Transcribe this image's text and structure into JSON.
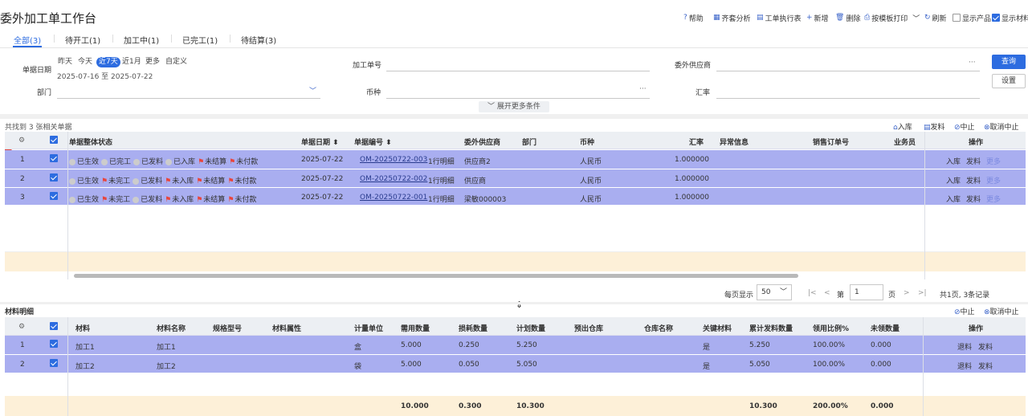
{
  "header": {
    "title": "委外加工单工作台",
    "toolbar": {
      "help": "帮助",
      "kit_analysis": "齐套分析",
      "exec_table": "工单执行表",
      "new": "新增",
      "delete": "删除",
      "print": "按模板打印",
      "refresh": "刷新",
      "show_product": "显示产品",
      "show_material": "显示材料"
    }
  },
  "tabs": [
    "全部(3)",
    "待开工(1)",
    "加工中(1)",
    "已完工(1)",
    "待结算(3)"
  ],
  "filters": {
    "date_label": "单据日期",
    "date_chips": [
      "昨天",
      "今天",
      "近7天",
      "近1月",
      "更多",
      "自定义"
    ],
    "date_range": "2025-07-16 至 2025-07-22",
    "order_no_label": "加工单号",
    "supplier_label": "委外供应商",
    "dept_label": "部门",
    "currency_label": "币种",
    "rate_label": "汇率",
    "ellipsis": "···",
    "search_btn": "查询",
    "settings_btn": "设置",
    "expand": "展开更多条件"
  },
  "list": {
    "found": "共找到 3 张相关单据",
    "actions": [
      "入库",
      "发料",
      "中止",
      "取消中止"
    ],
    "columns": [
      "单据整体状态",
      "单据日期",
      "单据编号",
      "委外供应商",
      "部门",
      "币种",
      "汇率",
      "异常信息",
      "销售订单号",
      "业务员",
      "操作"
    ],
    "rows": [
      {
        "idx": "1",
        "statuses": [
          [
            "dot",
            "已生效"
          ],
          [
            "dot",
            "已完工"
          ],
          [
            "dot",
            "已发料"
          ],
          [
            "dot",
            "已入库"
          ],
          [
            "flag",
            "未结算"
          ],
          [
            "flag",
            "未付款"
          ]
        ],
        "date": "2025-07-22",
        "code": "OM-20250722-003",
        "detail": "1行明细",
        "supplier": "供应商2",
        "dept": "",
        "currency": "人民币",
        "rate": "1.000000",
        "ops": [
          "入库",
          "发料",
          "更多"
        ]
      },
      {
        "idx": "2",
        "statuses": [
          [
            "dot",
            "已生效"
          ],
          [
            "flag",
            "未完工"
          ],
          [
            "dot",
            "已发料"
          ],
          [
            "flag",
            "未入库"
          ],
          [
            "flag",
            "未结算"
          ],
          [
            "flag",
            "未付款"
          ]
        ],
        "date": "2025-07-22",
        "code": "OM-20250722-002",
        "detail": "1行明细",
        "supplier": "供应商",
        "dept": "",
        "currency": "人民币",
        "rate": "1.000000",
        "ops": [
          "入库",
          "发料",
          "更多"
        ]
      },
      {
        "idx": "3",
        "statuses": [
          [
            "dot",
            "已生效"
          ],
          [
            "flag",
            "未完工"
          ],
          [
            "dot",
            "已发料"
          ],
          [
            "flag",
            "未入库"
          ],
          [
            "flag",
            "未结算"
          ],
          [
            "flag",
            "未付款"
          ]
        ],
        "date": "2025-07-22",
        "code": "OM-20250722-001",
        "detail": "1行明细",
        "supplier": "梁敏000003",
        "dept": "",
        "currency": "人民币",
        "rate": "1.000000",
        "ops": [
          "入库",
          "发料",
          "更多"
        ]
      }
    ]
  },
  "pager": {
    "per_page_label": "每页显示",
    "per_page": "50",
    "page_prefix": "第",
    "page": "1",
    "page_suffix": "页",
    "summary": "共1页, 3条记录"
  },
  "materials": {
    "title": "材料明细",
    "actions": [
      "中止",
      "取消中止"
    ],
    "columns": [
      "材料",
      "材料名称",
      "规格型号",
      "材料属性",
      "计量单位",
      "需用数量",
      "损耗数量",
      "计划数量",
      "预出仓库",
      "仓库名称",
      "关键材料",
      "累计发料数量",
      "领用比例%",
      "未领数量",
      "操作"
    ],
    "rows": [
      {
        "idx": "1",
        "code": "加工1",
        "name": "加工1",
        "unit": "盒",
        "need": "5.000",
        "loss": "0.250",
        "plan": "5.250",
        "key": "是",
        "issued": "5.250",
        "ratio": "100.00%",
        "remain": "0.000",
        "ops": [
          "退料",
          "发料"
        ]
      },
      {
        "idx": "2",
        "code": "加工2",
        "name": "加工2",
        "unit": "袋",
        "need": "5.000",
        "loss": "0.050",
        "plan": "5.050",
        "key": "是",
        "issued": "5.050",
        "ratio": "100.00%",
        "remain": "0.000",
        "ops": [
          "退料",
          "发料"
        ]
      }
    ],
    "totals": {
      "need": "10.000",
      "loss": "0.300",
      "plan": "10.300",
      "issued": "10.300",
      "ratio": "200.00%",
      "remain": "0.000"
    }
  },
  "colors": {
    "accent": "#2d6ce0",
    "row_selected": "#a9aef0",
    "summary": "#fdf0d8",
    "flag": "#e8453c"
  }
}
